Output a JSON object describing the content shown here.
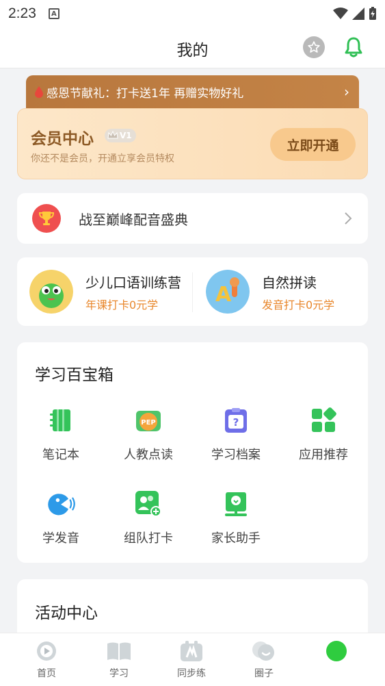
{
  "status_bar": {
    "time": "2:23",
    "notification_glyph": "A"
  },
  "header": {
    "title": "我的",
    "star_icon": "star-icon",
    "bell_icon": "bell-icon"
  },
  "promo": {
    "text": "感恩节献礼：打卡送1年 再赠实物好礼",
    "chevron": "›"
  },
  "vip": {
    "title": "会员中心",
    "level": "V1",
    "subtitle": "你还不是会员，开通立享会员特权",
    "button": "立即开通"
  },
  "event": {
    "label": "战至巅峰配音盛典"
  },
  "courses": [
    {
      "title": "少儿口语训练营",
      "subtitle": "年课打卡0元学"
    },
    {
      "title": "自然拼读",
      "subtitle": "发音打卡0元学"
    }
  ],
  "toolbox": {
    "title": "学习百宝箱",
    "tools": [
      {
        "label": "笔记本",
        "icon": "notebook-icon"
      },
      {
        "label": "人教点读",
        "icon": "pep-icon"
      },
      {
        "label": "学习档案",
        "icon": "archive-icon"
      },
      {
        "label": "应用推荐",
        "icon": "apps-icon"
      },
      {
        "label": "学发音",
        "icon": "pronunciation-icon"
      },
      {
        "label": "组队打卡",
        "icon": "team-checkin-icon"
      },
      {
        "label": "家长助手",
        "icon": "parent-assistant-icon"
      }
    ],
    "pep_badge": "PEP"
  },
  "activity": {
    "title": "活动中心"
  },
  "tabbar": {
    "tabs": [
      {
        "label": "首页",
        "icon": "home-play-icon"
      },
      {
        "label": "学习",
        "icon": "book-icon"
      },
      {
        "label": "同步练",
        "icon": "sync-practice-icon"
      },
      {
        "label": "圈子",
        "icon": "community-icon"
      },
      {
        "label": "",
        "icon": "profile-icon"
      }
    ]
  },
  "colors": {
    "accent_green": "#2fbf54",
    "vip_brown": "#8d5a26",
    "promo_brown": "#bd7d41",
    "course_orange": "#e8862a"
  }
}
